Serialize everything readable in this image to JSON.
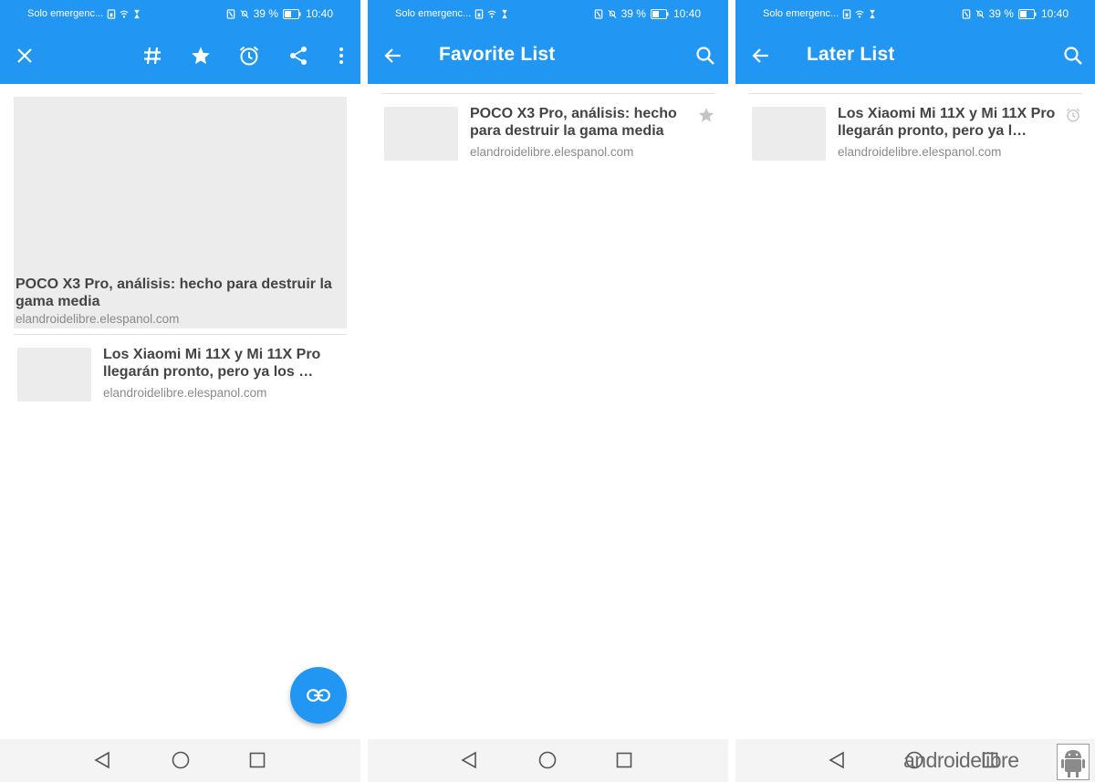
{
  "status_bar": {
    "carrier": "Solo emergenc...",
    "battery_percent": "39 %",
    "time": "10:40"
  },
  "screens": [
    {
      "toolbar": {
        "close_icon": "close-icon",
        "actions": [
          "hashtag-icon",
          "star-icon",
          "alarm-icon",
          "share-icon",
          "more-vert-icon"
        ]
      },
      "articles": [
        {
          "title": "POCO X3 Pro, análisis: hecho para destruir la gama media",
          "source": "elandroidelibre.elespanol.com"
        },
        {
          "title": "Los Xiaomi Mi 11X y Mi 11X Pro llegarán pronto, pero ya los …",
          "source": "elandroidelibre.elespanol.com"
        }
      ],
      "fab_icon": "link-icon"
    },
    {
      "toolbar": {
        "title": "Favorite List"
      },
      "articles": [
        {
          "title": "POCO X3 Pro, análisis: hecho para destruir la gama media",
          "source": "elandroidelibre.elespanol.com",
          "mark_icon": "star-icon"
        }
      ]
    },
    {
      "toolbar": {
        "title": "Later List"
      },
      "articles": [
        {
          "title": "Los Xiaomi Mi 11X y Mi 11X Pro llegarán pronto, pero ya l…",
          "source": "elandroidelibre.elespanol.com",
          "mark_icon": "alarm-icon"
        }
      ]
    }
  ],
  "nav_bar": [
    "back-triangle-icon",
    "home-circle-icon",
    "recents-square-icon"
  ],
  "watermark": "androidelibre",
  "colors": {
    "primary": "#2196f3",
    "placeholder": "#ececec",
    "title_text": "#444444",
    "source_text": "#8a8a8a"
  }
}
